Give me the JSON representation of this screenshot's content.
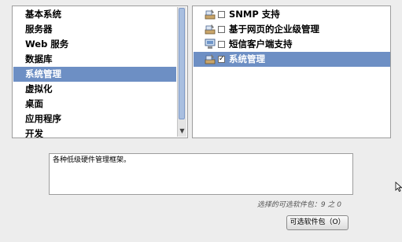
{
  "categories": {
    "items": [
      {
        "label": "基本系统",
        "selected": false
      },
      {
        "label": "服务器",
        "selected": false
      },
      {
        "label": "Web 服务",
        "selected": false
      },
      {
        "label": "数据库",
        "selected": false
      },
      {
        "label": "系统管理",
        "selected": true
      },
      {
        "label": "虚拟化",
        "selected": false
      },
      {
        "label": "桌面",
        "selected": false
      },
      {
        "label": "应用程序",
        "selected": false
      },
      {
        "label": "开发",
        "selected": false
      }
    ]
  },
  "packages": {
    "items": [
      {
        "label": "SNMP 支持",
        "checked": false,
        "selected": false,
        "icon": "package-admin-icon"
      },
      {
        "label": "基于网页的企业级管理",
        "checked": false,
        "selected": false,
        "icon": "package-admin-icon"
      },
      {
        "label": "短信客户端支持",
        "checked": false,
        "selected": false,
        "icon": "computer-icon"
      },
      {
        "label": "系统管理",
        "checked": true,
        "selected": true,
        "icon": "package-admin-icon"
      }
    ]
  },
  "description": {
    "text": "各种低级硬件管理框架。"
  },
  "status": {
    "count_text": "选择的可选软件包：9 之 0"
  },
  "buttons": {
    "optional_packages": "可选软件包（O）"
  },
  "colors": {
    "selection": "#6d8fc4",
    "background": "#ededed"
  }
}
